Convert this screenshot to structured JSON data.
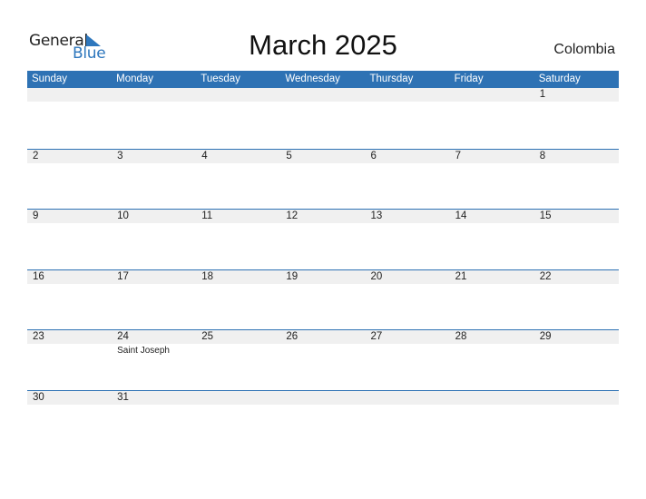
{
  "logo": {
    "text_general": "General",
    "text_blue": "Blue",
    "brand_color": "#2e77bd",
    "icon": "triangle-flag-icon"
  },
  "header": {
    "title": "March 2025",
    "country": "Colombia"
  },
  "colors": {
    "header_bg": "#2e72b4",
    "header_text": "#ffffff",
    "date_strip_bg": "#f0f0f0",
    "row_border": "#2e72b4"
  },
  "calendar": {
    "weekdays": [
      "Sunday",
      "Monday",
      "Tuesday",
      "Wednesday",
      "Thursday",
      "Friday",
      "Saturday"
    ],
    "weeks": [
      [
        {
          "day": ""
        },
        {
          "day": ""
        },
        {
          "day": ""
        },
        {
          "day": ""
        },
        {
          "day": ""
        },
        {
          "day": ""
        },
        {
          "day": "1"
        }
      ],
      [
        {
          "day": "2"
        },
        {
          "day": "3"
        },
        {
          "day": "4"
        },
        {
          "day": "5"
        },
        {
          "day": "6"
        },
        {
          "day": "7"
        },
        {
          "day": "8"
        }
      ],
      [
        {
          "day": "9"
        },
        {
          "day": "10"
        },
        {
          "day": "11"
        },
        {
          "day": "12"
        },
        {
          "day": "13"
        },
        {
          "day": "14"
        },
        {
          "day": "15"
        }
      ],
      [
        {
          "day": "16"
        },
        {
          "day": "17"
        },
        {
          "day": "18"
        },
        {
          "day": "19"
        },
        {
          "day": "20"
        },
        {
          "day": "21"
        },
        {
          "day": "22"
        }
      ],
      [
        {
          "day": "23"
        },
        {
          "day": "24",
          "event": "Saint Joseph"
        },
        {
          "day": "25"
        },
        {
          "day": "26"
        },
        {
          "day": "27"
        },
        {
          "day": "28"
        },
        {
          "day": "29"
        }
      ],
      [
        {
          "day": "30"
        },
        {
          "day": "31"
        },
        {
          "day": ""
        },
        {
          "day": ""
        },
        {
          "day": ""
        },
        {
          "day": ""
        },
        {
          "day": ""
        }
      ]
    ]
  }
}
